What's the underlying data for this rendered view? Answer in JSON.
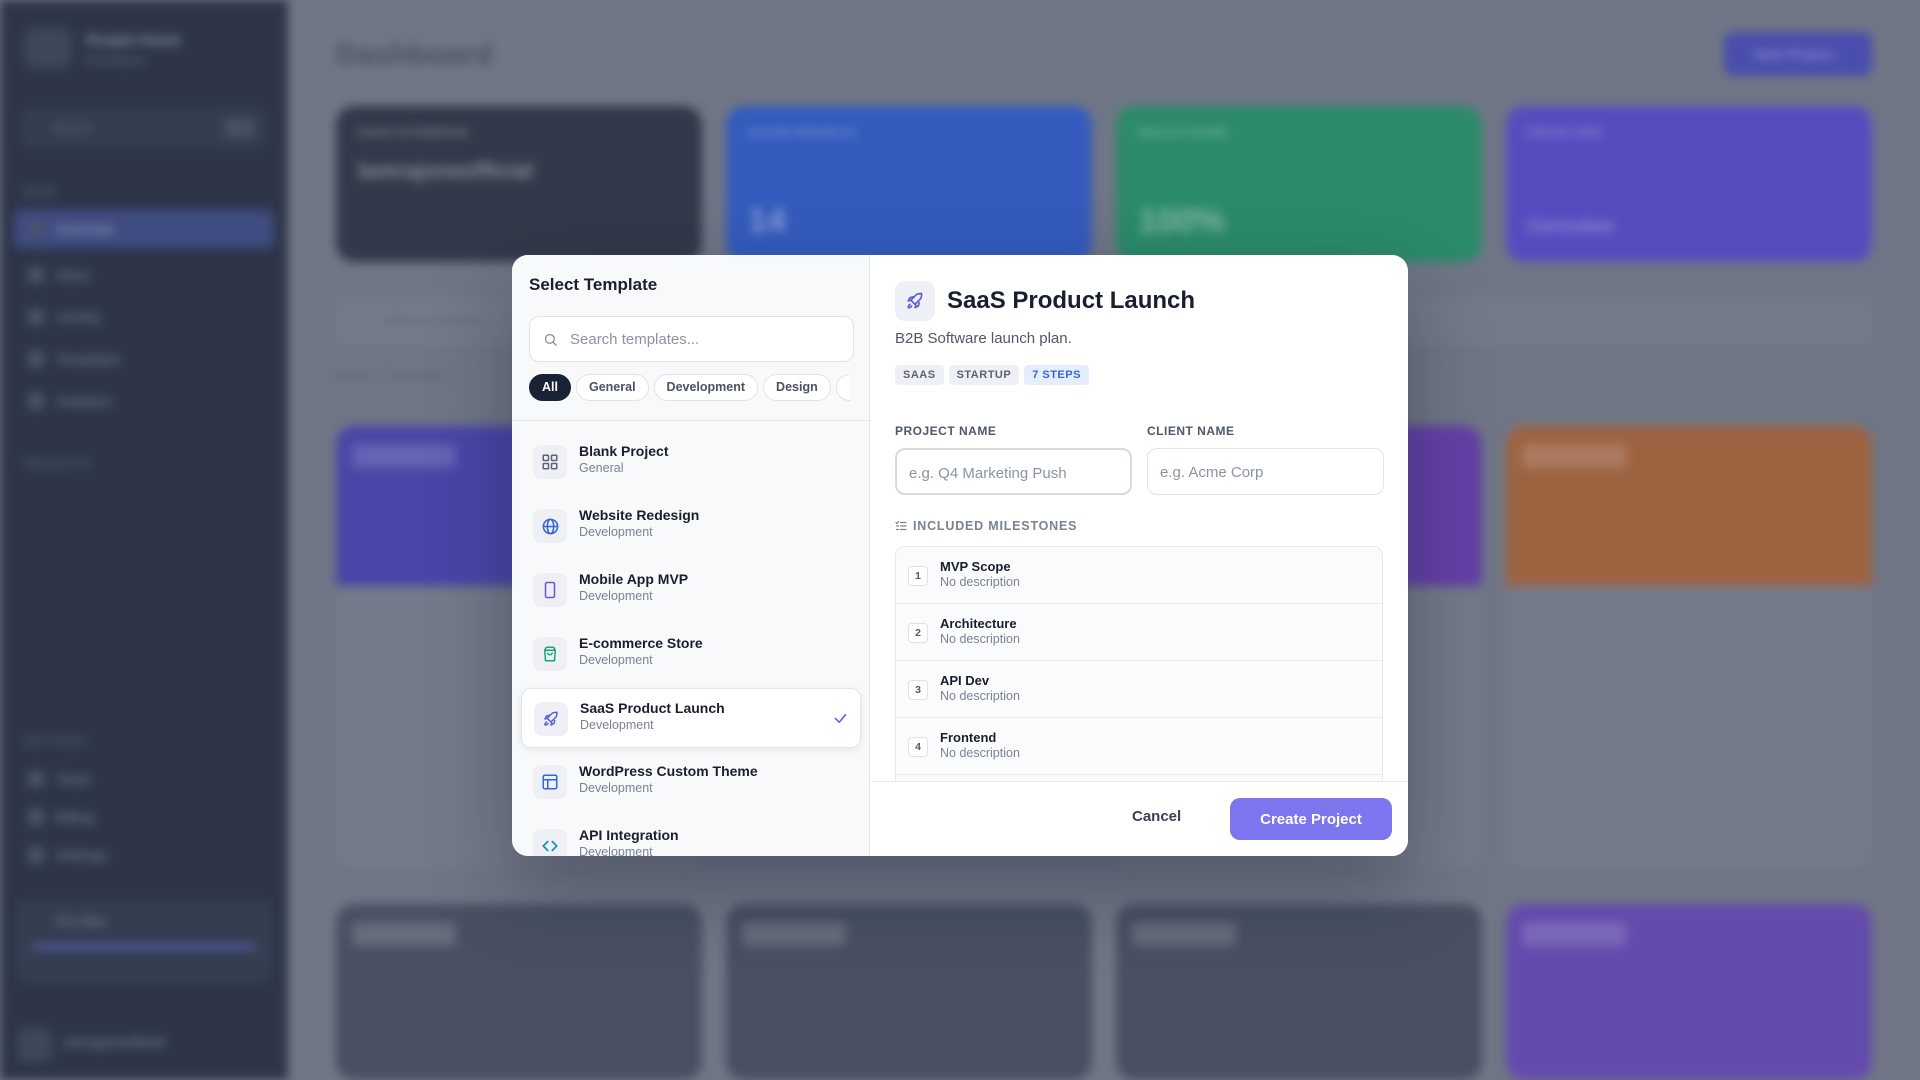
{
  "background": {
    "brand": "People Home",
    "brand_sub": "Workspace",
    "search_placeholder": "Search",
    "section_main": "MAIN",
    "nav": [
      "Overview",
      "Inbox",
      "Activity",
      "Templates",
      "Analytics"
    ],
    "section_projects": "PROJECTS",
    "section_settings": "SETTINGS",
    "settings_nav": [
      "Team",
      "Billing",
      "Settings"
    ],
    "plan_label": "Pro Plan",
    "user_name": "lamrajoneofficial",
    "page_title": "Dashboard",
    "new_project": "New Project",
    "stat_labels": [
      "GOOD AFTERNOON",
      "ACTIVE PROJECTS",
      "HEALTH SCORE",
      "FOCUS TASK"
    ],
    "stat_values": [
      "lamrajoneofficial",
      "14",
      "100%",
      "Curriculum"
    ],
    "projects_search": "Search projects...",
    "filter_tabs": [
      "Active",
      "Archived"
    ]
  },
  "modal": {
    "left_title": "Select Template",
    "search_placeholder": "Search templates...",
    "filters": [
      "All",
      "General",
      "Development",
      "Design"
    ],
    "templates": [
      {
        "name": "Blank Project",
        "category": "General",
        "icon": "grid-icon",
        "color": "#5b6478"
      },
      {
        "name": "Website Redesign",
        "category": "Development",
        "icon": "globe-icon",
        "color": "#3566d6"
      },
      {
        "name": "Mobile App MVP",
        "category": "Development",
        "icon": "smartphone-icon",
        "color": "#6b55e0"
      },
      {
        "name": "E-commerce Store",
        "category": "Development",
        "icon": "shopping-bag-icon",
        "color": "#16a37a"
      },
      {
        "name": "SaaS Product Launch",
        "category": "Development",
        "icon": "rocket-icon",
        "color": "#5a5fd6",
        "selected": true
      },
      {
        "name": "WordPress Custom Theme",
        "category": "Development",
        "icon": "layout-icon",
        "color": "#3566d6"
      },
      {
        "name": "API Integration",
        "category": "Development",
        "icon": "code-icon",
        "color": "#0f8fb8"
      }
    ],
    "detail": {
      "title": "SaaS Product Launch",
      "description": "B2B Software launch plan.",
      "tags": [
        "SAAS",
        "STARTUP"
      ],
      "steps_tag": "7 STEPS",
      "project_name_label": "PROJECT NAME",
      "project_name_placeholder": "e.g. Q4 Marketing Push",
      "client_name_label": "CLIENT NAME",
      "client_name_placeholder": "e.g. Acme Corp",
      "milestones_heading": "INCLUDED MILESTONES",
      "milestones": [
        {
          "num": "1",
          "title": "MVP Scope",
          "desc": "No description"
        },
        {
          "num": "2",
          "title": "Architecture",
          "desc": "No description"
        },
        {
          "num": "3",
          "title": "API Dev",
          "desc": "No description"
        },
        {
          "num": "4",
          "title": "Frontend",
          "desc": "No description"
        }
      ]
    },
    "cancel_label": "Cancel",
    "create_label": "Create Project",
    "accent": "#7b76ee"
  }
}
